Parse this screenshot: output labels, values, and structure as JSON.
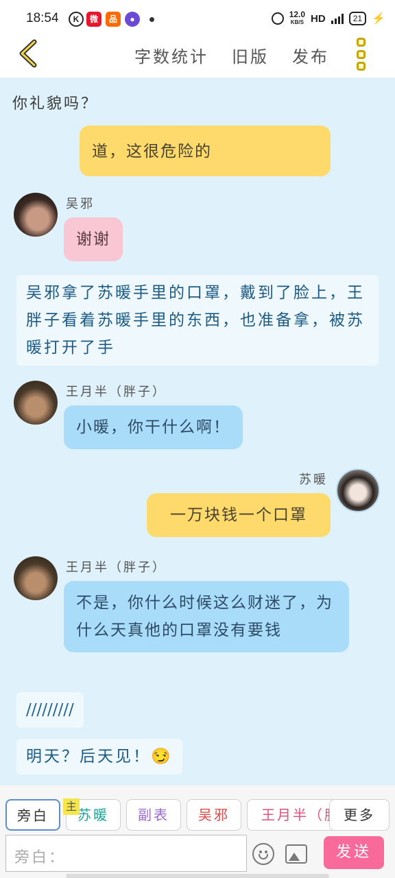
{
  "status_bar": {
    "time": "18:54",
    "icons": [
      "k-icon",
      "weibo-icon",
      "app-icon",
      "vpn-icon",
      "notification-dot"
    ],
    "net_speed": "12.0",
    "net_unit": "KB/S",
    "hd": "HD",
    "network": "4G",
    "battery": "21"
  },
  "header": {
    "back_icon": "chevron-left-icon",
    "links": [
      "字数统计",
      "旧版",
      "发布"
    ],
    "menu_icon": "vertical-dots-icon"
  },
  "chat": {
    "partial_top_line": "你礼貌吗？",
    "partial_bubble": "道，这很危险的",
    "messages": [
      {
        "name": "吴邪",
        "text": "谢谢"
      },
      {
        "narration": "吴邪拿了苏暖手里的口罩，戴到了脸上，王胖子看着苏暖手里的东西，也准备拿，被苏暖打开了手"
      },
      {
        "name": "王月半（胖子）",
        "text": "小暖，你干什么啊！"
      },
      {
        "name": "苏暖",
        "text": "一万块钱一个口罩"
      },
      {
        "name": "王月半（胖子）",
        "text": "不是，你什么时候这么财迷了，为什么天真他的口罩没有要钱"
      },
      {
        "narration": "/////////"
      },
      {
        "narration": "明天？后天见！😏"
      }
    ]
  },
  "roles": {
    "aside": "旁白",
    "main_tag": "主",
    "su": "苏暖",
    "side": "副表",
    "wu": "吴邪",
    "fat": "王月半（胖",
    "more": "更多"
  },
  "input": {
    "placeholder": "旁白：",
    "send": "发送"
  }
}
